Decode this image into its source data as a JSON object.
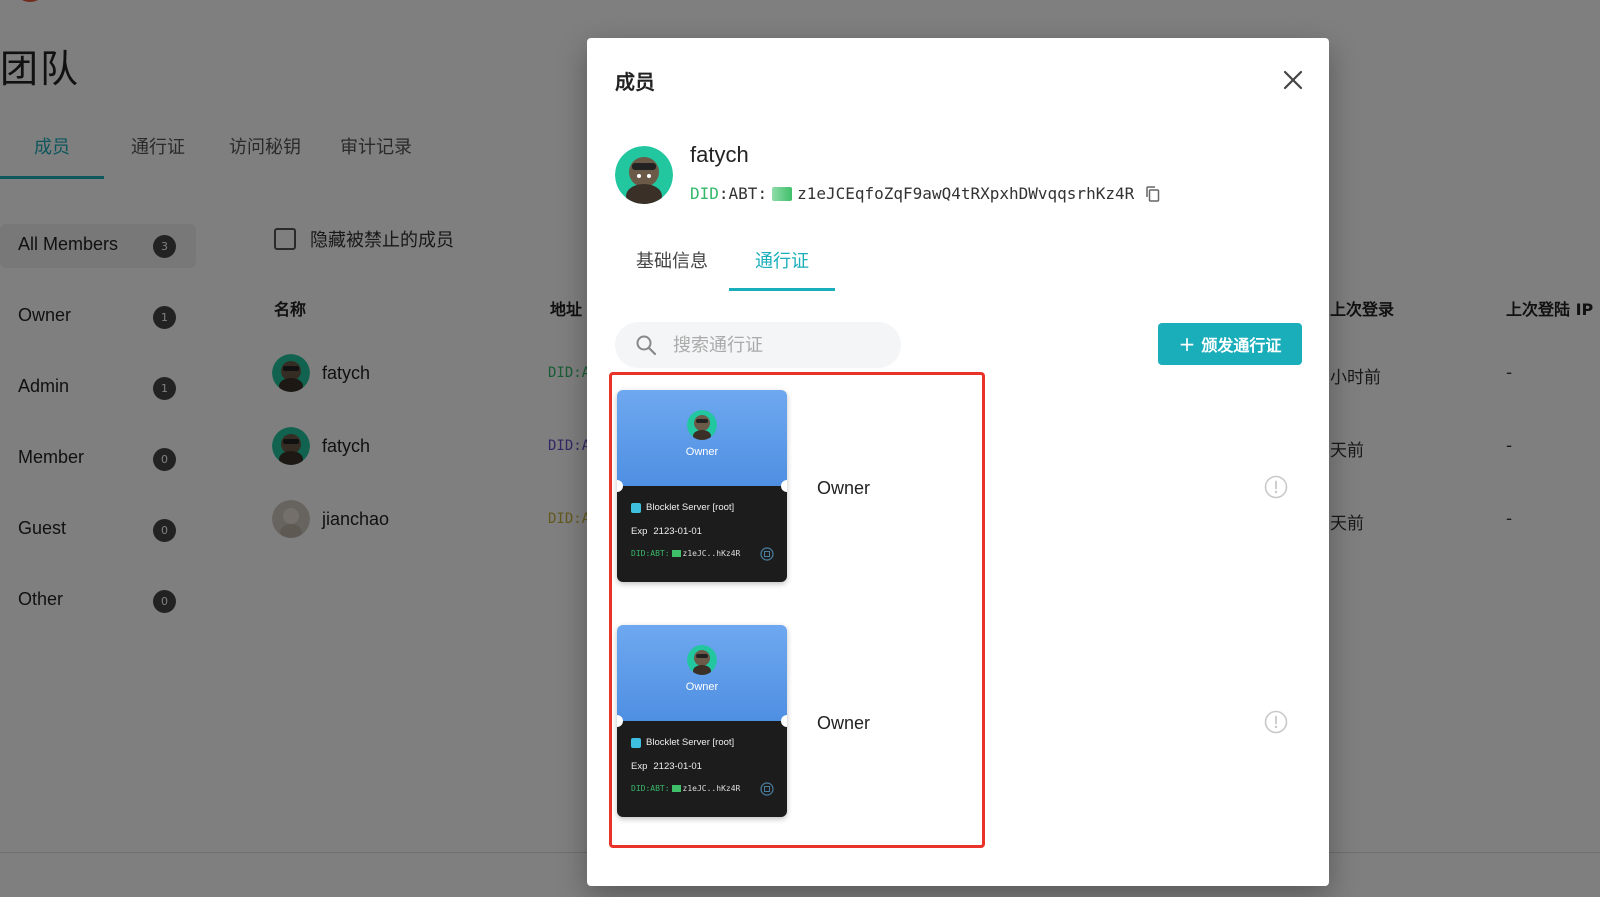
{
  "page": {
    "title": "团队",
    "tabs": [
      "成员",
      "通行证",
      "访问秘钥",
      "审计记录"
    ],
    "filter_label": "隐藏被禁止的成员",
    "sidebar": [
      {
        "label": "All Members",
        "count": "3"
      },
      {
        "label": "Owner",
        "count": "1"
      },
      {
        "label": "Admin",
        "count": "1"
      },
      {
        "label": "Member",
        "count": "0"
      },
      {
        "label": "Guest",
        "count": "0"
      },
      {
        "label": "Other",
        "count": "0"
      }
    ],
    "table": {
      "headers": {
        "name": "名称",
        "address": "地址",
        "last_login": "上次登录",
        "last_ip": "上次登陆 IP"
      },
      "rows": [
        {
          "name": "fatych",
          "address": "DID:A",
          "last_login": "小时前",
          "ip": "-",
          "addr_color": "#33b86a"
        },
        {
          "name": "fatych",
          "address": "DID:A",
          "last_login": "天前",
          "ip": "-",
          "addr_color": "#6a4fc9"
        },
        {
          "name": "jianchao",
          "address": "DID:A",
          "last_login": "天前",
          "ip": "-",
          "addr_color": "#c9b23a"
        }
      ]
    }
  },
  "dialog": {
    "title": "成员",
    "user": {
      "name": "fatych",
      "did_prefix": "DID",
      "did_sep": ":ABT:",
      "did_value": "z1eJCEqfoZqF9awQ4tRXpxhDWvqqsrhKz4R"
    },
    "tabs": [
      "基础信息",
      "通行证"
    ],
    "active_tab": "通行证",
    "search_placeholder": "搜索通行证",
    "issue_button": "颁发通行证",
    "passports": [
      {
        "card_role": "Owner",
        "issuer": "Blocklet Server [root]",
        "exp_label": "Exp",
        "exp_value": "2123-01-01",
        "did_prefix": "DID:ABT:",
        "did_short": "z1eJC..hKz4R",
        "role": "Owner"
      },
      {
        "card_role": "Owner",
        "issuer": "Blocklet Server [root]",
        "exp_label": "Exp",
        "exp_value": "2123-01-01",
        "did_prefix": "DID:ABT:",
        "did_short": "z1eJC..hKz4R",
        "role": "Owner"
      }
    ]
  },
  "colors": {
    "accent": "#1aaebb",
    "highlight": "#e8322a",
    "did_green": "#33b86a",
    "card_blue": "#5b9be8",
    "card_dark": "#1c1c1c"
  },
  "icons": [
    "close-icon",
    "copy-icon",
    "search-icon",
    "plus-icon",
    "info-icon",
    "qr-icon"
  ]
}
